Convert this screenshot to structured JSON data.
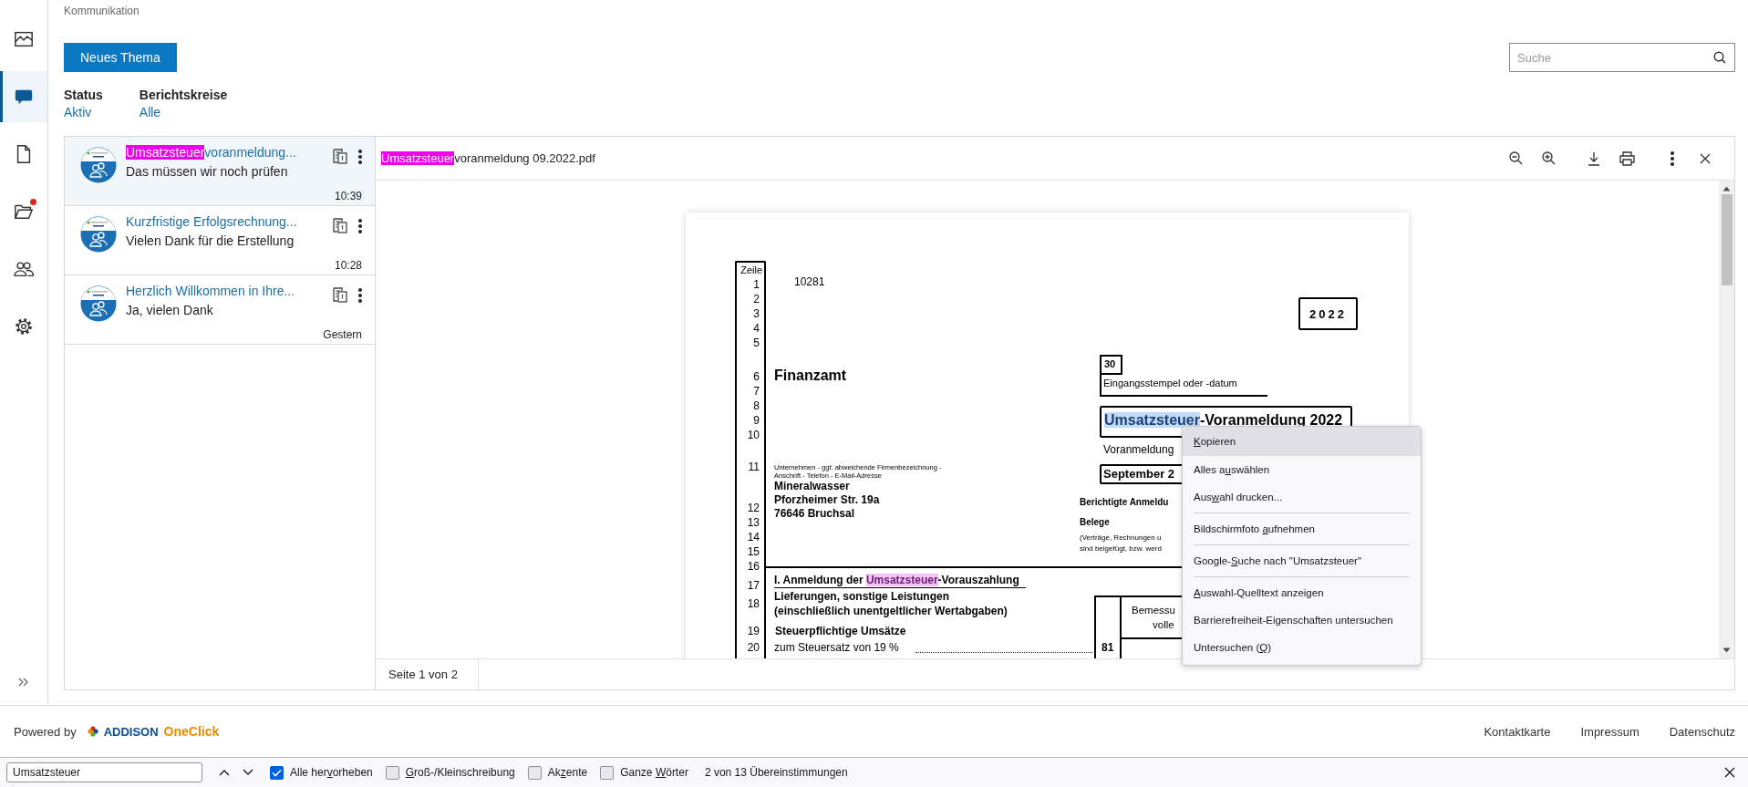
{
  "rail": {
    "items": [
      {
        "kind": "chart",
        "selected": false,
        "notification": false
      },
      {
        "kind": "chat",
        "selected": true,
        "notification": false
      },
      {
        "kind": "document",
        "selected": false,
        "notification": false
      },
      {
        "kind": "folder",
        "selected": false,
        "notification": true
      },
      {
        "kind": "people",
        "selected": false,
        "notification": false
      },
      {
        "kind": "settings",
        "selected": false,
        "notification": false
      }
    ]
  },
  "breadcrumb": "Kommunikation",
  "new_button": "Neues Thema",
  "search": {
    "placeholder": "Suche"
  },
  "filters": [
    {
      "label": "Status",
      "value": "Aktiv"
    },
    {
      "label": "Berichtskreise",
      "value": "Alle"
    }
  ],
  "threads": [
    {
      "selected": true,
      "title": [
        {
          "text": "Umsatzsteuer",
          "kind": "current"
        },
        {
          "text": "voranmeldung...",
          "kind": "plain"
        }
      ],
      "preview": "Das müssen wir noch prüfen",
      "time": "10:39"
    },
    {
      "selected": false,
      "title": [
        {
          "text": "Kurzfristige Erfolgsrechnung...",
          "kind": "plain"
        }
      ],
      "preview": "Vielen Dank für die Erstellung",
      "time": "10:28"
    },
    {
      "selected": false,
      "title": [
        {
          "text": "Herzlich Willkommen in Ihre...",
          "kind": "plain"
        }
      ],
      "preview": "Ja, vielen Dank",
      "time": "Gestern"
    }
  ],
  "viewer": {
    "file_name": [
      {
        "text": "Umsatzsteuer",
        "kind": "current"
      },
      {
        "text": "voranmeldung 09.2022.pdf",
        "kind": "plain"
      }
    ],
    "page_info": "Seite 1 von 2",
    "document": {
      "line_header": "Zeile",
      "lines": [
        "1",
        "2",
        "3",
        "4",
        "5",
        "6",
        "7",
        "8",
        "9",
        "10",
        "11",
        "12",
        "13",
        "14",
        "15",
        "16",
        "17",
        "18",
        "19",
        "20"
      ],
      "tax_number": "10281",
      "year": "2022",
      "office": "Finanzamt",
      "box_number": "30",
      "stamp_label": "Eingangsstempel oder -datum",
      "form_title": [
        {
          "text": "Umsatzsteuer",
          "kind": "selection"
        },
        {
          "text": "-Voranmeldung 2022",
          "kind": "plain"
        }
      ],
      "period_label": "Voranmeldung",
      "period_value": "September 2",
      "company_caption": [
        "Unternehmen - ggf. abweichende Firmenbezeichnung -",
        "Anschrift - Telefon - E-Mail-Adresse"
      ],
      "company": [
        "Mineralwasser",
        "Pforzheimer Str. 19a",
        "76646 Bruchsal"
      ],
      "corrected": "Berichtigte Anmeldu",
      "receipts": "Belege",
      "receipts_note": [
        "(Verträge, Rechnungen u",
        "sind beigefügt, bzw. werd"
      ],
      "section_title": [
        {
          "text": "I. Anmeldung der ",
          "kind": "plain"
        },
        {
          "text": "Umsatzsteuer",
          "kind": "match"
        },
        {
          "text": "-Vorauszahlung",
          "kind": "plain"
        }
      ],
      "deliveries": [
        "Lieferungen, sonstige Leistungen",
        "(einschließlich unentgeltlicher Wertabgaben)"
      ],
      "taxable": "Steuerpflichtige Umsätze",
      "rate_line": "zum Steuersatz von 19 %",
      "rate_code": "81",
      "column_header": [
        "Bemessu",
        "volle"
      ]
    }
  },
  "context_menu": [
    {
      "kind": "item",
      "label": [
        {
          "text": "K",
          "kind": "access_key"
        },
        {
          "text": "opieren",
          "kind": "plain"
        }
      ],
      "highlighted": true
    },
    {
      "kind": "item",
      "label": [
        {
          "text": "Alles a",
          "kind": "plain"
        },
        {
          "text": "u",
          "kind": "access_key"
        },
        {
          "text": "swählen",
          "kind": "plain"
        }
      ],
      "highlighted": false
    },
    {
      "kind": "item",
      "label": [
        {
          "text": "Aus",
          "kind": "plain"
        },
        {
          "text": "w",
          "kind": "access_key"
        },
        {
          "text": "ahl drucken...",
          "kind": "plain"
        }
      ],
      "highlighted": false
    },
    {
      "kind": "separator"
    },
    {
      "kind": "item",
      "label": [
        {
          "text": "Bildschirmfoto ",
          "kind": "plain"
        },
        {
          "text": "a",
          "kind": "access_key"
        },
        {
          "text": "ufnehmen",
          "kind": "plain"
        }
      ],
      "highlighted": false
    },
    {
      "kind": "separator"
    },
    {
      "kind": "item",
      "label": [
        {
          "text": "Google-",
          "kind": "plain"
        },
        {
          "text": "S",
          "kind": "access_key"
        },
        {
          "text": "uche nach \"Umsatzsteuer\"",
          "kind": "plain"
        }
      ],
      "highlighted": false
    },
    {
      "kind": "separator"
    },
    {
      "kind": "item",
      "label": [
        {
          "text": "A",
          "kind": "access_key"
        },
        {
          "text": "uswahl-Quelltext anzeigen",
          "kind": "plain"
        }
      ],
      "highlighted": false
    },
    {
      "kind": "item",
      "label": [
        {
          "text": "Barrierefreiheit-Eigenschaften untersuchen",
          "kind": "plain"
        }
      ],
      "highlighted": false
    },
    {
      "kind": "item",
      "label": [
        {
          "text": "Untersuchen (",
          "kind": "plain"
        },
        {
          "text": "Q",
          "kind": "access_key"
        },
        {
          "text": ")",
          "kind": "plain"
        }
      ],
      "highlighted": false
    }
  ],
  "footer": {
    "powered_by": "Powered by",
    "brand": "ADDISON",
    "product": "OneClick",
    "links": [
      "Kontaktkarte",
      "Impressum",
      "Datenschutz"
    ]
  },
  "find_bar": {
    "value": "Umsatzsteuer",
    "options": [
      {
        "label": [
          {
            "text": "Alle her",
            "kind": "plain"
          },
          {
            "text": "v",
            "kind": "access_key"
          },
          {
            "text": "orheben",
            "kind": "plain"
          }
        ],
        "checked": true
      },
      {
        "label": [
          {
            "text": "G",
            "kind": "access_key"
          },
          {
            "text": "roß-/Kleinschreibung",
            "kind": "plain"
          }
        ],
        "checked": false
      },
      {
        "label": [
          {
            "text": "Ak",
            "kind": "plain"
          },
          {
            "text": "z",
            "kind": "access_key"
          },
          {
            "text": "ente",
            "kind": "plain"
          }
        ],
        "checked": false
      },
      {
        "label": [
          {
            "text": "Ganze ",
            "kind": "plain"
          },
          {
            "text": "W",
            "kind": "access_key"
          },
          {
            "text": "örter",
            "kind": "plain"
          }
        ],
        "checked": false
      }
    ],
    "status": "2 von 13 Übereinstimmungen"
  }
}
